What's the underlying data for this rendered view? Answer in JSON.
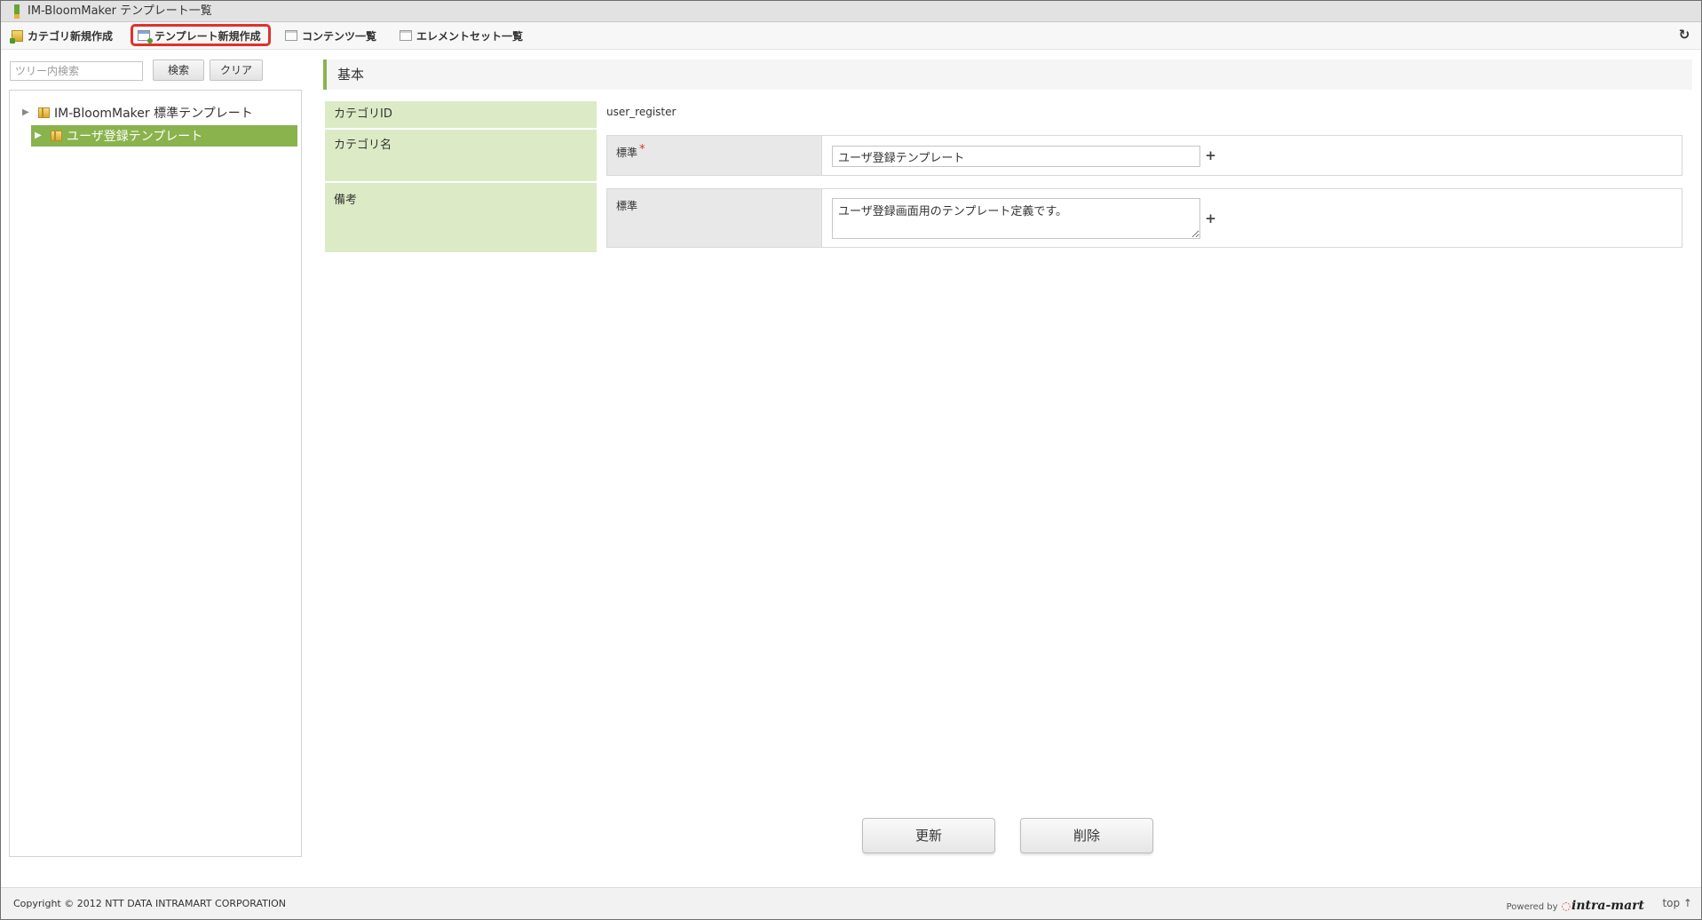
{
  "window": {
    "title": "IM-BloomMaker テンプレート一覧"
  },
  "toolbar": {
    "category_new": "カテゴリ新規作成",
    "template_new": "テンプレート新規作成",
    "contents_list": "コンテンツ一覧",
    "elementset_list": "エレメントセット一覧",
    "highlight_color": "#e0312d"
  },
  "tree": {
    "search_placeholder": "ツリー内検索",
    "search_button": "検索",
    "clear_button": "クリア",
    "items": [
      {
        "label": "IM-BloomMaker 標準テンプレート",
        "selected": false
      },
      {
        "label": "ユーザ登録テンプレート",
        "selected": true
      }
    ]
  },
  "form": {
    "section_title": "基本",
    "category_id_label": "カテゴリID",
    "category_id_value": "user_register",
    "category_name_label": "カテゴリ名",
    "category_name_locale": "標準",
    "category_name_required": "*",
    "category_name_value": "ユーザ登録テンプレート",
    "remarks_label": "備考",
    "remarks_locale": "標準",
    "remarks_value": "ユーザ登録画面用のテンプレート定義です。"
  },
  "actions": {
    "update": "更新",
    "delete": "削除"
  },
  "footer": {
    "copyright": "Copyright © 2012 NTT DATA INTRAMART CORPORATION",
    "powered_by": "Powered by",
    "brand": "intra-mart",
    "top_link": "top ↑"
  },
  "colors": {
    "accent_green": "#8ab34d",
    "label_bg": "#dcebc6",
    "required_red": "#e0312d"
  }
}
